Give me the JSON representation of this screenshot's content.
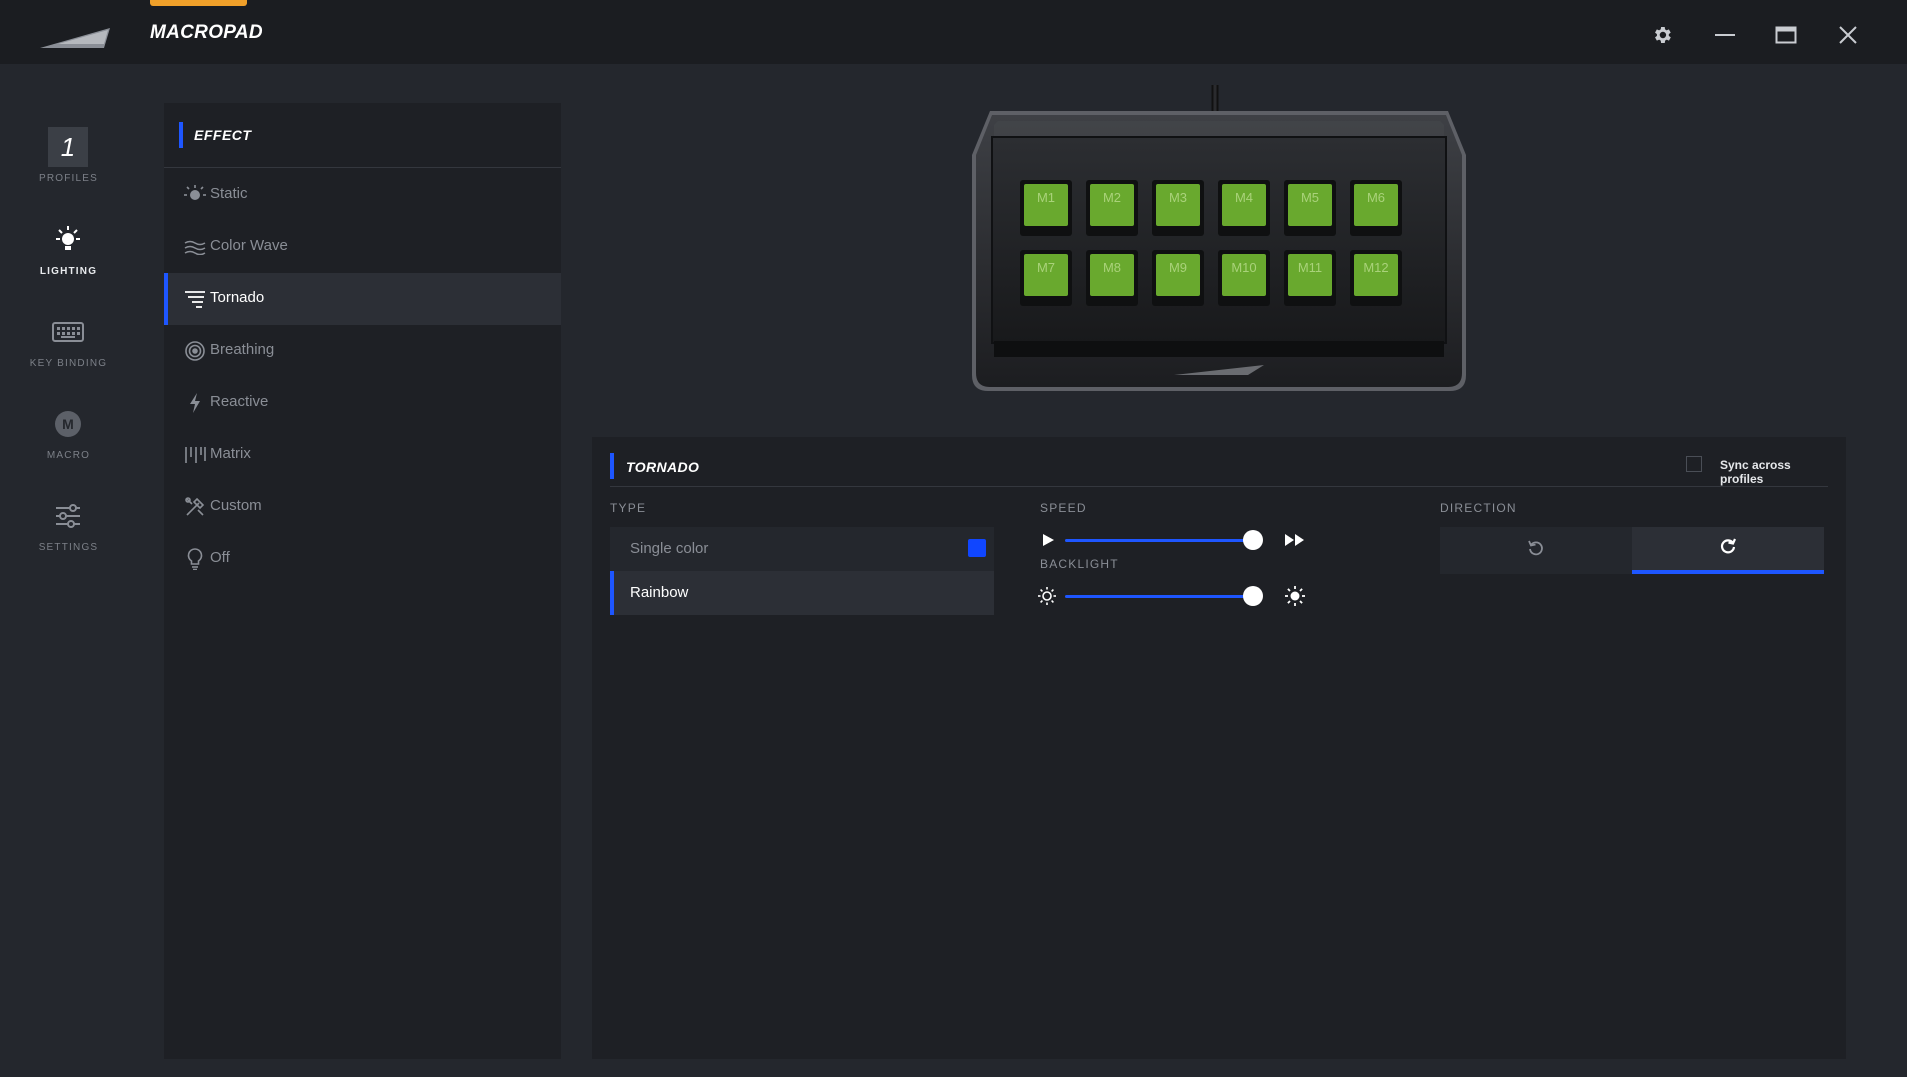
{
  "app": {
    "title": "MACROPAD",
    "accent_color": "#f0a02a",
    "highlight_color": "#1e56ff"
  },
  "window_controls": {
    "settings_icon": "gear-icon",
    "minimize_icon": "minimize-icon",
    "maximize_icon": "maximize-icon",
    "close_icon": "close-icon"
  },
  "nav": {
    "profile_number": "1",
    "items": [
      {
        "label": "PROFILES",
        "icon": "profile-number-box"
      },
      {
        "label": "LIGHTING",
        "icon": "bulb-icon",
        "active": true
      },
      {
        "label": "KEY BINDING",
        "icon": "keyboard-icon"
      },
      {
        "label": "MACRO",
        "icon": "macro-m-icon"
      },
      {
        "label": "SETTINGS",
        "icon": "sliders-icon"
      }
    ]
  },
  "effects": {
    "header": "EFFECT",
    "items": [
      {
        "label": "Static",
        "icon": "sun-icon"
      },
      {
        "label": "Color Wave",
        "icon": "wave-icon"
      },
      {
        "label": "Tornado",
        "icon": "tornado-icon",
        "active": true
      },
      {
        "label": "Breathing",
        "icon": "breathing-icon"
      },
      {
        "label": "Reactive",
        "icon": "bolt-icon"
      },
      {
        "label": "Matrix",
        "icon": "matrix-icon"
      },
      {
        "label": "Custom",
        "icon": "custom-icon"
      },
      {
        "label": "Off",
        "icon": "lightbulb-off-icon"
      }
    ]
  },
  "device": {
    "key_color": "#69a92e",
    "keys": [
      "M1",
      "M2",
      "M3",
      "M4",
      "M5",
      "M6",
      "M7",
      "M8",
      "M9",
      "M10",
      "M11",
      "M12"
    ]
  },
  "settings": {
    "title": "TORNADO",
    "sync_label": "Sync across profiles",
    "sync_checked": false,
    "type_label": "TYPE",
    "type_options": [
      "Single color",
      "Rainbow"
    ],
    "type_selected": "Rainbow",
    "single_color": "#1046ff",
    "speed_label": "SPEED",
    "speed_value": 1.0,
    "backlight_label": "BACKLIGHT",
    "backlight_value": 1.0,
    "direction_label": "DIRECTION",
    "direction_options": [
      "counterclockwise-icon",
      "clockwise-icon"
    ],
    "direction_selected": "clockwise"
  }
}
